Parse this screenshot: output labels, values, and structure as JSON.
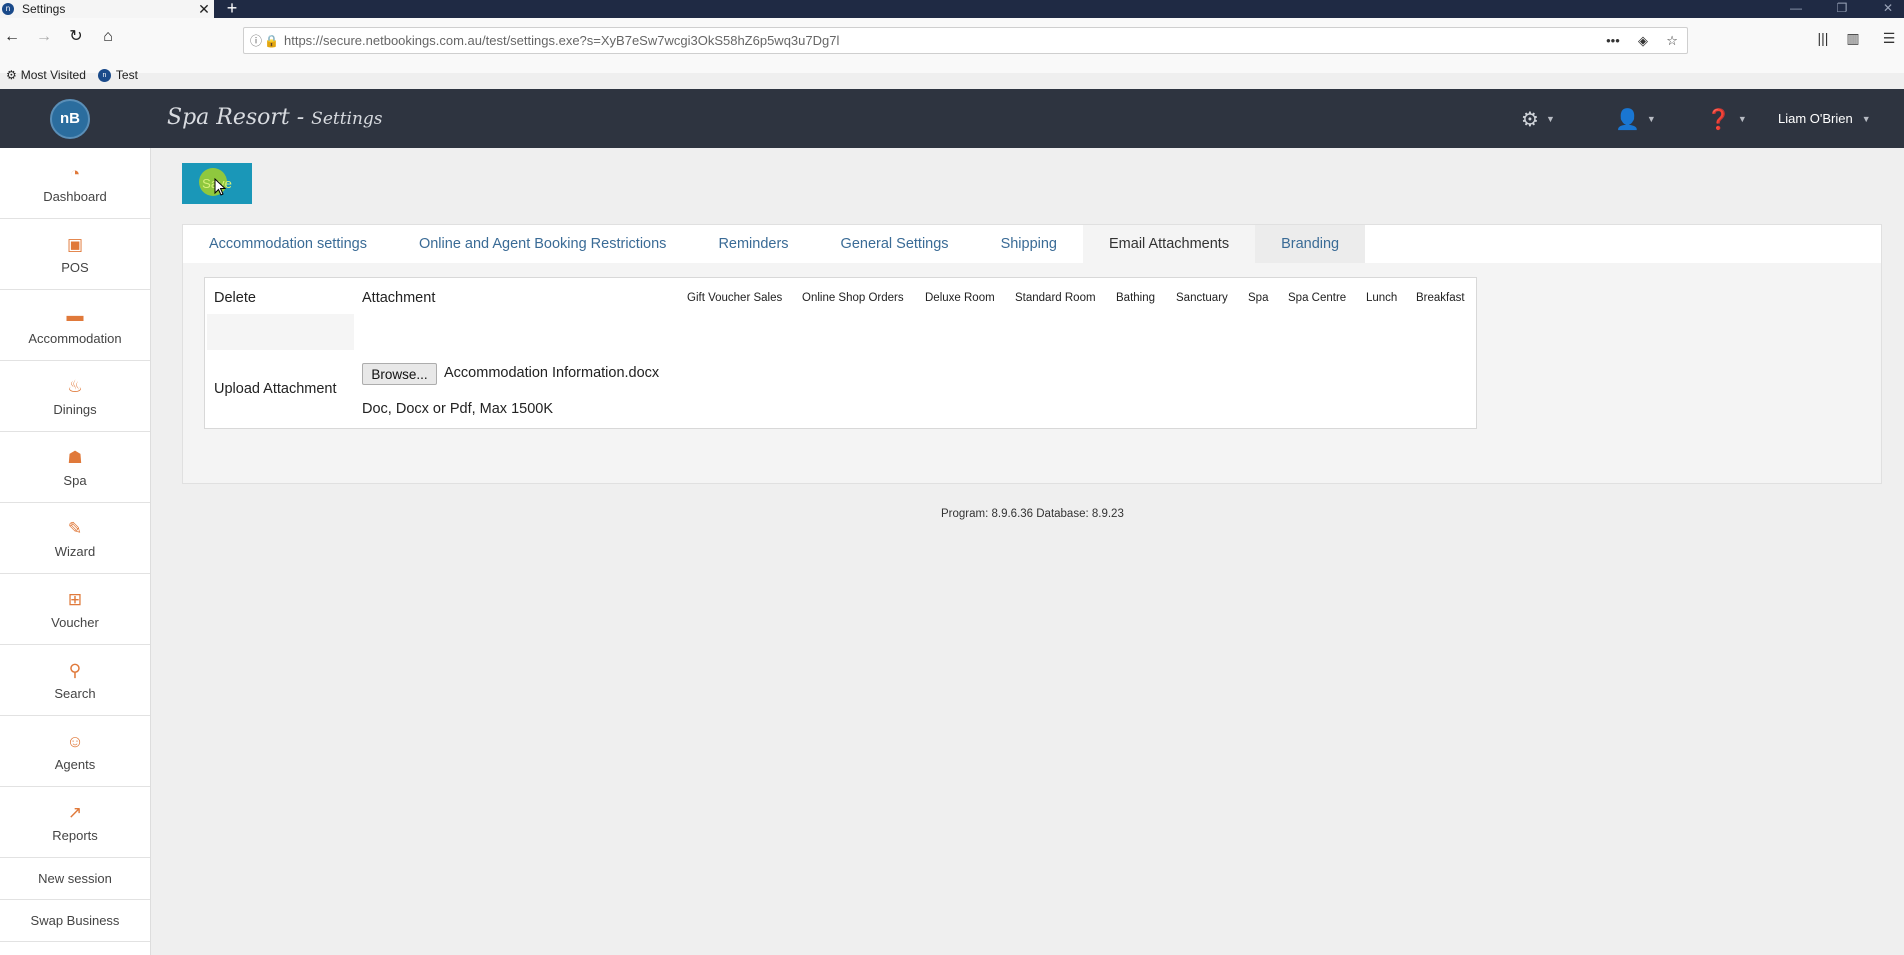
{
  "browser": {
    "tab_title": "Settings",
    "tab_close": "✕",
    "new_tab": "+",
    "url": "https://secure.netbookings.com.au/test/settings.exe?s=XyB7eSw7wcgi3OkS58hZ6p5wq3u7Dg7l",
    "bookmarks": [
      {
        "label": "Most Visited",
        "icon": "gear-icon"
      },
      {
        "label": "Test",
        "icon": "netbookings-favicon"
      }
    ]
  },
  "app": {
    "logo_text": "nB",
    "title_main": "Spa Resort - ",
    "title_sub": "Settings",
    "user_name": "Liam O'Brien",
    "header_icons": [
      "settings-gear-icon",
      "user-ninja-icon",
      "help-icon"
    ]
  },
  "sidebar": {
    "items": [
      {
        "label": "Dashboard",
        "icon": "gauge-icon"
      },
      {
        "label": "POS",
        "icon": "pos-terminal-icon"
      },
      {
        "label": "Accommodation",
        "icon": "bed-icon"
      },
      {
        "label": "Dinings",
        "icon": "dining-icon"
      },
      {
        "label": "Spa",
        "icon": "spa-massage-icon"
      },
      {
        "label": "Wizard",
        "icon": "magic-wand-icon"
      },
      {
        "label": "Voucher",
        "icon": "gift-icon"
      },
      {
        "label": "Search",
        "icon": "search-icon"
      },
      {
        "label": "Agents",
        "icon": "agent-icon"
      },
      {
        "label": "Reports",
        "icon": "chart-icon"
      }
    ],
    "links": [
      "New session",
      "Swap Business"
    ]
  },
  "main": {
    "save_label": "Save",
    "tabs": [
      {
        "label": "Accommodation settings"
      },
      {
        "label": "Online and Agent Booking Restrictions"
      },
      {
        "label": "Reminders"
      },
      {
        "label": "General Settings"
      },
      {
        "label": "Shipping"
      },
      {
        "label": "Email Attachments",
        "active": true
      },
      {
        "label": "Branding"
      }
    ],
    "table": {
      "col_delete": "Delete",
      "col_attachment": "Attachment",
      "categories": [
        "Gift Voucher Sales",
        "Online Shop Orders",
        "Deluxe Room",
        "Standard Room",
        "Bathing",
        "Sanctuary",
        "Spa",
        "Spa Centre",
        "Lunch",
        "Breakfast"
      ],
      "upload_label": "Upload Attachment",
      "browse_label": "Browse...",
      "selected_file": "Accommodation Information.docx",
      "file_hint": "Doc, Docx or Pdf, Max 1500K"
    }
  },
  "footer": {
    "version": "Program: 8.9.6.36 Database: 8.9.23"
  }
}
